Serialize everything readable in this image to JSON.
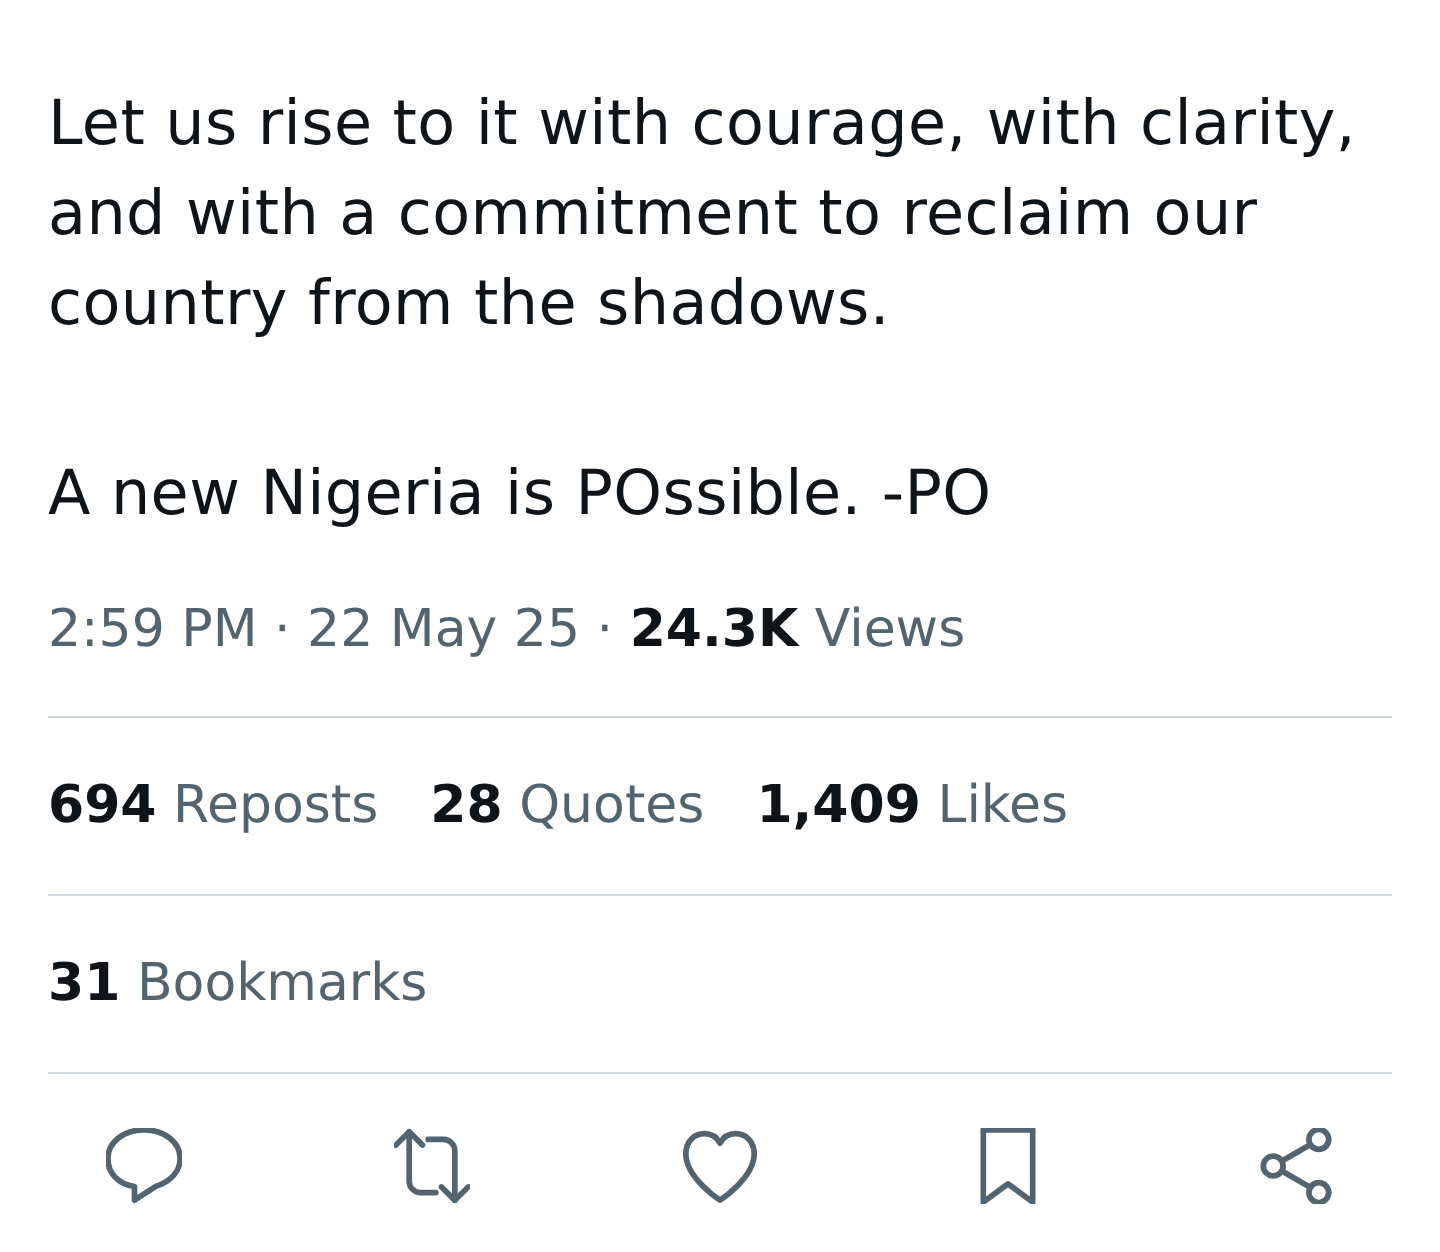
{
  "tweet": {
    "paragraphs": [
      "Let us rise to it with courage, with clarity, and with a commitment to reclaim our country from the shadows.",
      "A new Nigeria is POssible. -PO"
    ],
    "meta": "2:59 PM · 22 May 25 · **24.3K** Views",
    "stats": [
      {
        "count": "694",
        "label": "Reposts"
      },
      {
        "count": "28",
        "label": "Quotes"
      },
      {
        "count": "1,409",
        "label": "Likes"
      }
    ],
    "bookmarks": {
      "count": "31",
      "label": "Bookmarks"
    },
    "actions": [
      {
        "kind": "reply"
      },
      {
        "kind": "repost"
      },
      {
        "kind": "like"
      },
      {
        "kind": "bookmark"
      },
      {
        "kind": "share"
      }
    ]
  }
}
